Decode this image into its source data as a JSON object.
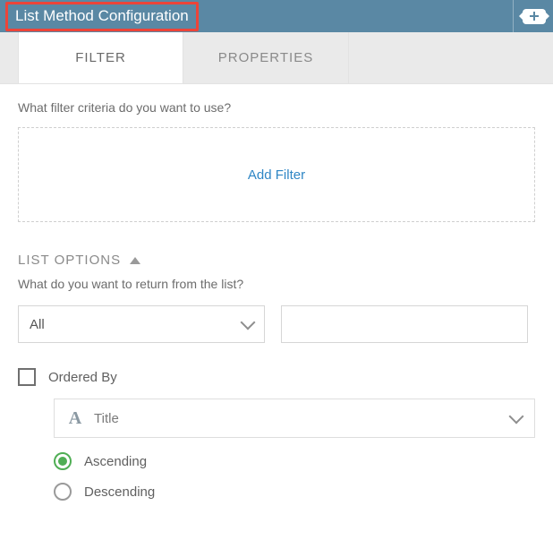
{
  "header": {
    "title": "List Method Configuration"
  },
  "tabs": {
    "filter": "FILTER",
    "properties": "PROPERTIES"
  },
  "filter": {
    "prompt": "What filter criteria do you want to use?",
    "add_filter": "Add Filter"
  },
  "list_options": {
    "heading": "LIST OPTIONS",
    "prompt": "What do you want to return from the list?",
    "return_select": "All",
    "return_value": "",
    "ordered_by_label": "Ordered By",
    "ordered_by_checked": false,
    "field_label": "Title",
    "sort": {
      "asc": "Ascending",
      "desc": "Descending",
      "selected": "asc"
    }
  }
}
